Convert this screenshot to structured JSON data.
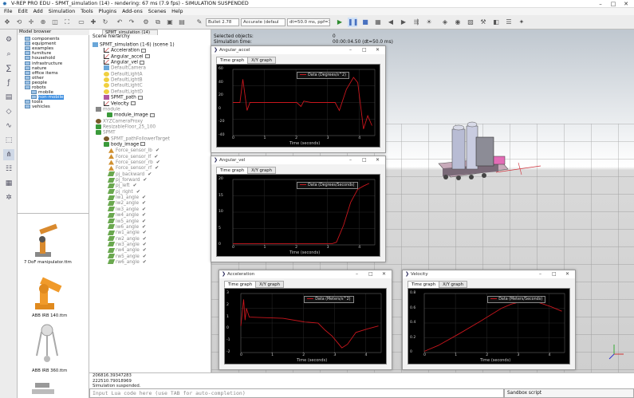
{
  "window": {
    "title": "V-REP PRO EDU - SPMT_simulation (14) - rendering: 67 ms (7.9 fps) - SIMULATION SUSPENDED",
    "min": "–",
    "max": "□",
    "close": "✕"
  },
  "menu": [
    "File",
    "Edit",
    "Add",
    "Simulation",
    "Tools",
    "Plugins",
    "Add-ons",
    "Scenes",
    "Help"
  ],
  "toolbar": {
    "engine": "Bullet 2.78",
    "accuracy": "Accurate (defaul",
    "timestep": "dt=50.0 ms, ppf=1"
  },
  "model_browser": {
    "header": "Model browser",
    "items": [
      "components",
      "equipment",
      "examples",
      "furniture",
      "household",
      "infrastructure",
      "nature",
      "office items",
      "other",
      "people",
      "robots",
      "mobile",
      "non-mobile",
      "tools",
      "vehicles"
    ],
    "selected": "non-mobile"
  },
  "thumbnails": [
    "7 DoF manipulator.ttm",
    "ABB IRB 140.ttm",
    "ABB IRB 360.ttm"
  ],
  "hierarchy": {
    "tab": "SPMT_simulation (14)",
    "header": "Scene hierarchy",
    "items": [
      {
        "label": "SPMT_simulation (1-6) (scene 1)",
        "icon": "scene",
        "grey": false
      },
      {
        "label": "Acceleration",
        "icon": "graph",
        "grey": false
      },
      {
        "label": "Angular_accel",
        "icon": "graph",
        "grey": false
      },
      {
        "label": "Angular_vel",
        "icon": "graph",
        "grey": false
      },
      {
        "label": "DefaultCamera",
        "icon": "cam",
        "grey": true
      },
      {
        "label": "DefaultLightA",
        "icon": "light",
        "grey": true
      },
      {
        "label": "DefaultLightB",
        "icon": "light",
        "grey": true
      },
      {
        "label": "DefaultLightC",
        "icon": "light",
        "grey": true
      },
      {
        "label": "DefaultLightD",
        "icon": "light",
        "grey": true
      },
      {
        "label": "SPMT_path",
        "icon": "path",
        "grey": false
      },
      {
        "label": "Velocity",
        "icon": "graph",
        "grey": false
      },
      {
        "label": "module",
        "icon": "mod",
        "grey": true
      },
      {
        "label": "module_image",
        "icon": "shape",
        "grey": false
      },
      {
        "label": "XYZCameraProxy",
        "icon": "dummy",
        "grey": true
      },
      {
        "label": "ResizableFloor_25_100",
        "icon": "shape",
        "grey": true
      },
      {
        "label": "SPMT",
        "icon": "shape",
        "grey": true
      },
      {
        "label": "SPMT_pathFollowerTarget",
        "icon": "dummy",
        "grey": true
      },
      {
        "label": "body_image",
        "icon": "shape",
        "grey": false
      },
      {
        "label": "Force_sensor_lb",
        "icon": "sensor",
        "grey": true
      },
      {
        "label": "Force_sensor_lf",
        "icon": "sensor",
        "grey": true
      },
      {
        "label": "Force_sensor_rb",
        "icon": "sensor",
        "grey": true
      },
      {
        "label": "Force_sensor_rf",
        "icon": "sensor",
        "grey": true
      },
      {
        "label": "pj_backward",
        "icon": "joint",
        "grey": true
      },
      {
        "label": "pj_forward",
        "icon": "joint",
        "grey": true
      },
      {
        "label": "pj_left",
        "icon": "joint",
        "grey": true
      },
      {
        "label": "pj_right",
        "icon": "joint",
        "grey": true
      },
      {
        "label": "lw1_angle",
        "icon": "joint",
        "grey": true
      },
      {
        "label": "lw2_angle",
        "icon": "joint",
        "grey": true
      },
      {
        "label": "lw3_angle",
        "icon": "joint",
        "grey": true
      },
      {
        "label": "lw4_angle",
        "icon": "joint",
        "grey": true
      },
      {
        "label": "lw5_angle",
        "icon": "joint",
        "grey": true
      },
      {
        "label": "lw6_angle",
        "icon": "joint",
        "grey": true
      },
      {
        "label": "rw1_angle",
        "icon": "joint",
        "grey": true
      },
      {
        "label": "rw2_angle",
        "icon": "joint",
        "grey": true
      },
      {
        "label": "rw3_angle",
        "icon": "joint",
        "grey": true
      },
      {
        "label": "rw4_angle",
        "icon": "joint",
        "grey": true
      },
      {
        "label": "rw5_angle",
        "icon": "joint",
        "grey": true
      },
      {
        "label": "rw6_angle",
        "icon": "joint",
        "grey": true
      }
    ]
  },
  "scene_info": {
    "selected_label": "Selected objects:",
    "selected_value": "0",
    "simtime_label": "Simulation time:",
    "simtime_value": "00:00:04.50 (dt=50.0 ms)"
  },
  "graphs": [
    {
      "title": "Angular_accel",
      "tab1": "Time graph",
      "tab2": "X/Y graph",
      "legend": "Data (Degrees/s^2)",
      "xlabel": "Time (seconds)",
      "yticks": [
        "60",
        "40",
        "20",
        "0",
        "-20",
        "-40"
      ],
      "xticks": [
        "0",
        "1",
        "2",
        "3",
        "4"
      ]
    },
    {
      "title": "Angular_vel",
      "tab1": "Time graph",
      "tab2": "X/Y graph",
      "legend": "Data (Degrees/Seconds)",
      "xlabel": "Time (seconds)",
      "yticks": [
        "20",
        "15",
        "10",
        "5",
        "0"
      ],
      "xticks": [
        "0",
        "1",
        "2",
        "3",
        "4"
      ]
    },
    {
      "title": "Acceleration",
      "tab1": "Time graph",
      "tab2": "X/Y graph",
      "legend": "Data (Meters/s^2)",
      "xlabel": "Time (seconds)",
      "yticks": [
        "3",
        "2",
        "1",
        "0",
        "-1",
        "-2"
      ],
      "xticks": [
        "0",
        "1",
        "2",
        "3",
        "4"
      ]
    },
    {
      "title": "Velocity",
      "tab1": "Time graph",
      "tab2": "X/Y graph",
      "legend": "Data (Meters/Seconds)",
      "xlabel": "Time (seconds)",
      "yticks": [
        "0.8",
        "0.6",
        "0.4",
        "0.2",
        "0"
      ],
      "xticks": [
        "0",
        "1",
        "2",
        "3",
        "4"
      ]
    }
  ],
  "console": [
    "206816.39347283",
    "222510.79018969",
    "Simulation suspended."
  ],
  "lua_placeholder": "Input Lua code here (use TAB for auto-completion)",
  "sandbox": "Sandbox script",
  "colors": {
    "plot_line": "#c8161d",
    "selection": "#3d8ee0"
  }
}
